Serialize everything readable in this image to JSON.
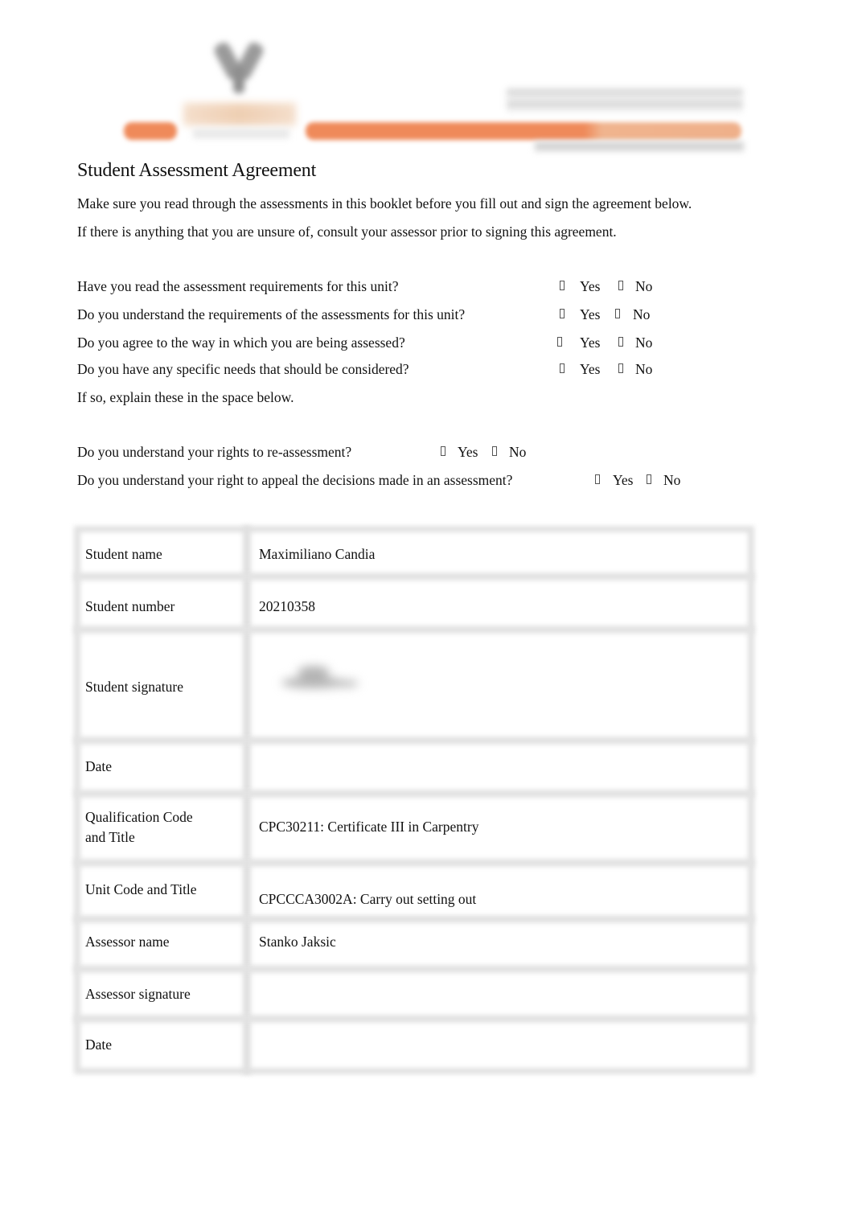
{
  "document": {
    "title": "Student Assessment Agreement",
    "intro": [
      "Make sure you read through the assessments in this booklet before you fill out and sign the agreement below.",
      "If there is anything that you are unsure of, consult your assessor prior to signing this agreement."
    ],
    "option_labels": {
      "yes": "Yes",
      "no": "No"
    },
    "questions": [
      {
        "text": "Have you read the assessment requirements for this unit?",
        "yes_checked": false,
        "no_checked": false
      },
      {
        "text": "Do you understand the requirements of the assessments for this unit?",
        "yes_checked": false,
        "no_checked": false
      },
      {
        "text": "Do you agree to the way in which you are being assessed?",
        "yes_checked": false,
        "no_checked": false
      },
      {
        "text": "Do you have any specific needs that should be considered?",
        "yes_checked": false,
        "no_checked": false
      }
    ],
    "explain_note": "If so, explain these in the space below.",
    "rights_questions": [
      {
        "text": "Do you understand your rights to re-assessment?",
        "yes_checked": false,
        "no_checked": false
      },
      {
        "text": "Do you understand your right to appeal the decisions made in an assessment?",
        "yes_checked": false,
        "no_checked": false
      }
    ]
  },
  "table": {
    "rows": [
      {
        "label": "Student name",
        "value": "Maximiliano Candia"
      },
      {
        "label": "Student number",
        "value": "20210358"
      },
      {
        "label": "Student signature",
        "value": ""
      },
      {
        "label": "Date",
        "value": ""
      },
      {
        "label": "Qualification Code\nand Title",
        "label_lines": [
          "Qualification Code",
          "and Title"
        ],
        "value": "CPC30211: Certificate III in Carpentry"
      },
      {
        "label": "Unit Code and Title",
        "value": "CPCCCA3002A: Carry out setting out"
      },
      {
        "label": "Assessor name",
        "value": "Stanko Jaksic"
      },
      {
        "label": "Assessor signature",
        "value": ""
      },
      {
        "label": "Date",
        "value": ""
      }
    ]
  },
  "colors": {
    "accent_orange": "#ef8a5a",
    "text": "#111111"
  }
}
